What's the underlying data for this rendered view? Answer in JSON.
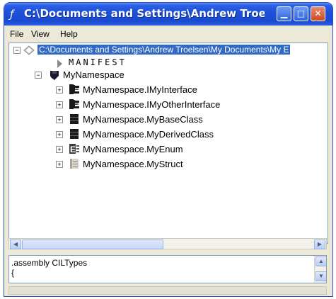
{
  "window": {
    "title": "C:\\Documents and Settings\\Andrew Troe...",
    "icon": "quill-icon",
    "buttons": [
      "minimize",
      "maximize",
      "close"
    ]
  },
  "menu": {
    "items": [
      {
        "label": "File"
      },
      {
        "label": "View"
      },
      {
        "label": "Help"
      }
    ]
  },
  "tree": {
    "root": {
      "label": "C:\\Documents and Settings\\Andrew Troelsen\\My Documents\\My E"
    },
    "manifest": {
      "label": "MANIFEST"
    },
    "namespace": {
      "label": "MyNamespace"
    },
    "types": [
      {
        "label": "MyNamespace.IMyInterface",
        "icon": "interface-icon"
      },
      {
        "label": "MyNamespace.IMyOtherInterface",
        "icon": "interface-icon"
      },
      {
        "label": "MyNamespace.MyBaseClass",
        "icon": "class-icon"
      },
      {
        "label": "MyNamespace.MyDerivedClass",
        "icon": "class-icon"
      },
      {
        "label": "MyNamespace.MyEnum",
        "icon": "enum-icon"
      },
      {
        "label": "MyNamespace.MyStruct",
        "icon": "struct-icon"
      }
    ]
  },
  "details": {
    "line1": ".assembly CILTypes",
    "line2": "{"
  }
}
